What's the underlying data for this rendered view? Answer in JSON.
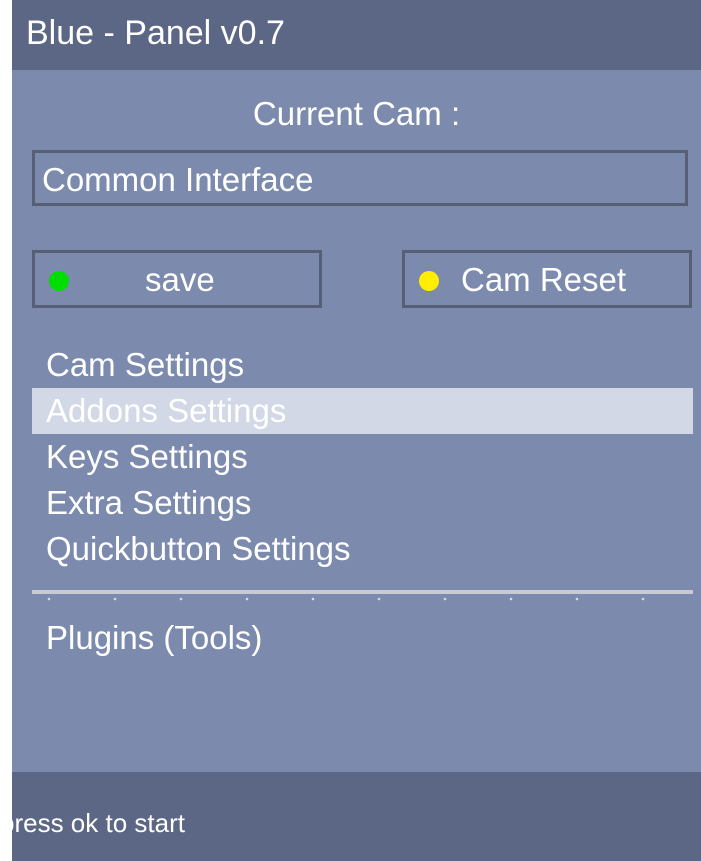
{
  "window": {
    "title": "Blue - Panel v0.7"
  },
  "current_cam": {
    "label": "Current Cam :",
    "value": "Common Interface"
  },
  "buttons": {
    "save": {
      "label": "save",
      "indicator_color": "#00dd00"
    },
    "cam_reset": {
      "label": "Cam Reset",
      "indicator_color": "#ffee00"
    }
  },
  "menu": {
    "items": [
      {
        "label": "Cam Settings",
        "selected": false
      },
      {
        "label": "Addons Settings",
        "selected": true
      },
      {
        "label": "Keys Settings",
        "selected": false
      },
      {
        "label": "Extra Settings",
        "selected": false
      },
      {
        "label": "Quickbutton Settings",
        "selected": false
      }
    ],
    "plugins_label": "Plugins (Tools)"
  },
  "status": {
    "text": "press ok to start"
  },
  "colors": {
    "background": "#7c8bad",
    "bars": "#5c6785",
    "selected_row": "#d2d8e6",
    "text": "#ffffff"
  }
}
